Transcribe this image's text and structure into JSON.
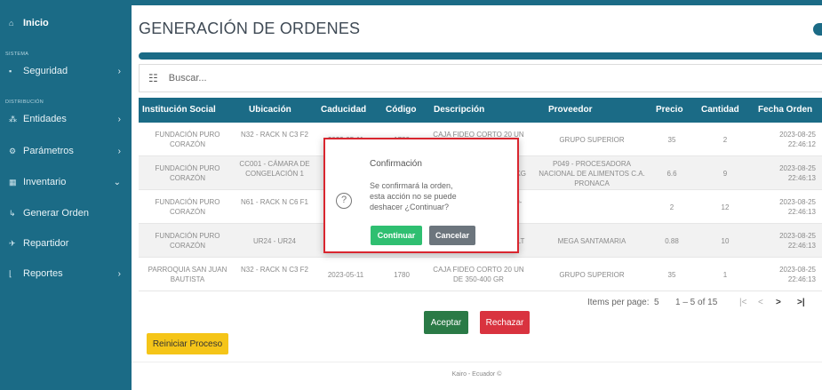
{
  "sidebar": {
    "home": "Inicio",
    "section_sistema": "SISTEMA",
    "section_distribucion": "DISTRIBUCIÓN",
    "items": [
      {
        "label": "Seguridad"
      },
      {
        "label": "Entidades"
      },
      {
        "label": "Parámetros"
      },
      {
        "label": "Inventario"
      },
      {
        "label": "Generar Orden"
      },
      {
        "label": "Repartidor"
      },
      {
        "label": "Reportes"
      }
    ]
  },
  "header": {
    "title": "GENERACIÓN DE ORDENES"
  },
  "search": {
    "placeholder": "Buscar..."
  },
  "table": {
    "columns": [
      "Institución Social",
      "Ubicación",
      "Caducidad",
      "Código",
      "Descripción",
      "Proveedor",
      "Precio",
      "Cantidad",
      "Fecha Orden"
    ],
    "rows": [
      {
        "inst": "FUNDACIÓN PURO CORAZÓN",
        "ubic": "N32 - RACK N C3 F2",
        "cad": "2023-05-11",
        "cod": "1780",
        "desc": "CAJA FIDEO CORTO 20 UN DE 350-400 GR",
        "prov": "GRUPO SUPERIOR",
        "precio": "35",
        "cant": "2",
        "fecha": "2023-08-25 22:46:12"
      },
      {
        "inst": "FUNDACIÓN PURO CORAZÓN",
        "ubic": "CC001 - CÁMARA DE CONGELACIÓN 1",
        "cad": "",
        "cod": "",
        "desc": "...4-5 KG",
        "prov": "P049 - PROCESADORA NACIONAL DE ALIMENTOS C.A. PRONACA",
        "precio": "6.6",
        "cant": "9",
        "fecha": "2023-08-25 22:46:13"
      },
      {
        "inst": "FUNDACIÓN PURO CORAZÓN",
        "ubic": "N61 - RACK N C6 F1",
        "cad": "",
        "cod": "",
        "desc": "...950-",
        "prov": "",
        "precio": "2",
        "cant": "12",
        "fecha": "2023-08-25 22:46:13"
      },
      {
        "inst": "FUNDACIÓN PURO CORAZÓN",
        "ubic": "UR24 - UR24",
        "cad": "",
        "cod": "",
        "desc": "...1.5 LT",
        "prov": "MEGA SANTAMARIA",
        "precio": "0.88",
        "cant": "10",
        "fecha": "2023-08-25 22:46:13"
      },
      {
        "inst": "PARROQUIA SAN JUAN BAUTISTA",
        "ubic": "N32 - RACK N C3 F2",
        "cad": "2023-05-11",
        "cod": "1780",
        "desc": "CAJA FIDEO CORTO 20 UN DE 350-400 GR",
        "prov": "GRUPO SUPERIOR",
        "precio": "35",
        "cant": "1",
        "fecha": "2023-08-25 22:46:13"
      }
    ]
  },
  "pager": {
    "items_label": "Items per page:",
    "page_size": "5",
    "range": "1 – 5 of 15",
    "first": "|<",
    "prev": "<",
    "next": ">",
    "last": ">|"
  },
  "actions": {
    "accept": "Aceptar",
    "reject": "Rechazar",
    "restart": "Reiniciar Proceso"
  },
  "footer": {
    "text": "Kairo - Ecuador ©"
  },
  "dialog": {
    "title": "Confirmación",
    "message": "Se confirmará la orden, esta acción no se puede deshacer ¿Continuar?",
    "confirm": "Continuar",
    "cancel": "Cancelar",
    "icon": "?"
  }
}
